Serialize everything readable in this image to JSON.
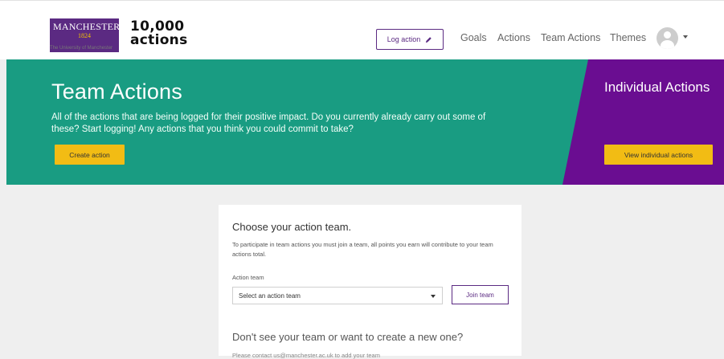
{
  "header": {
    "uom_name": "MANCHESTER",
    "uom_year": "1824",
    "uom_sub": "The University of Manchester",
    "logo_line1": "10,000",
    "logo_line2": "actions",
    "log_action": "Log action",
    "nav": [
      "Goals",
      "Actions",
      "Team Actions",
      "Themes"
    ]
  },
  "hero": {
    "title": "Team Actions",
    "description": "All of the actions that are being logged for their positive impact. Do you currently already carry out some of these? Start logging! Any actions that you think you could commit to take?",
    "create_button": "Create action",
    "side_title": "Individual Actions",
    "side_button": "View individual actions"
  },
  "card": {
    "title": "Choose your action team.",
    "description": "To participate in team actions you must join a team, all points you earn will contribute to your team actions total.",
    "field_label": "Action team",
    "select_value": "Select an action team",
    "join_button": "Join team",
    "title2": "Don't see your team or want to create a new one?",
    "cut_text": "Please contact us@manchester.ac.uk to add your team"
  },
  "colors": {
    "teal": "#199c82",
    "purple": "#6a0d91",
    "yellow": "#f2bc14",
    "uom_purple": "#5b2a82"
  }
}
